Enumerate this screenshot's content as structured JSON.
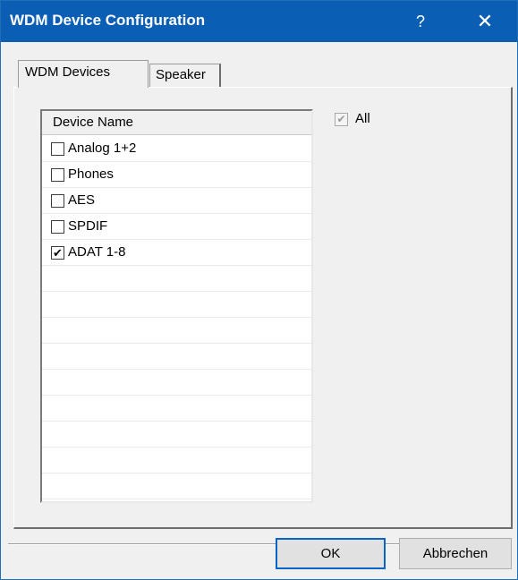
{
  "window": {
    "title": "WDM Device Configuration",
    "help_glyph": "?",
    "close_glyph": "✕"
  },
  "tabs": [
    {
      "label": "WDM Devices",
      "active": true
    },
    {
      "label": "Speaker",
      "active": false
    }
  ],
  "device_list": {
    "header": "Device Name",
    "items": [
      {
        "label": "Analog 1+2",
        "checked": false,
        "mark": ""
      },
      {
        "label": "Phones",
        "checked": false,
        "mark": ""
      },
      {
        "label": "AES",
        "checked": false,
        "mark": ""
      },
      {
        "label": "SPDIF",
        "checked": false,
        "mark": ""
      },
      {
        "label": "ADAT 1-8",
        "checked": true,
        "mark": "✔"
      }
    ]
  },
  "all_checkbox": {
    "label": "All",
    "checked": true,
    "disabled": true,
    "mark": "✔"
  },
  "buttons": {
    "ok": "OK",
    "cancel": "Abbrechen"
  },
  "colors": {
    "title_bar": "#0a5fb4",
    "ok_border": "#0a63c7"
  }
}
